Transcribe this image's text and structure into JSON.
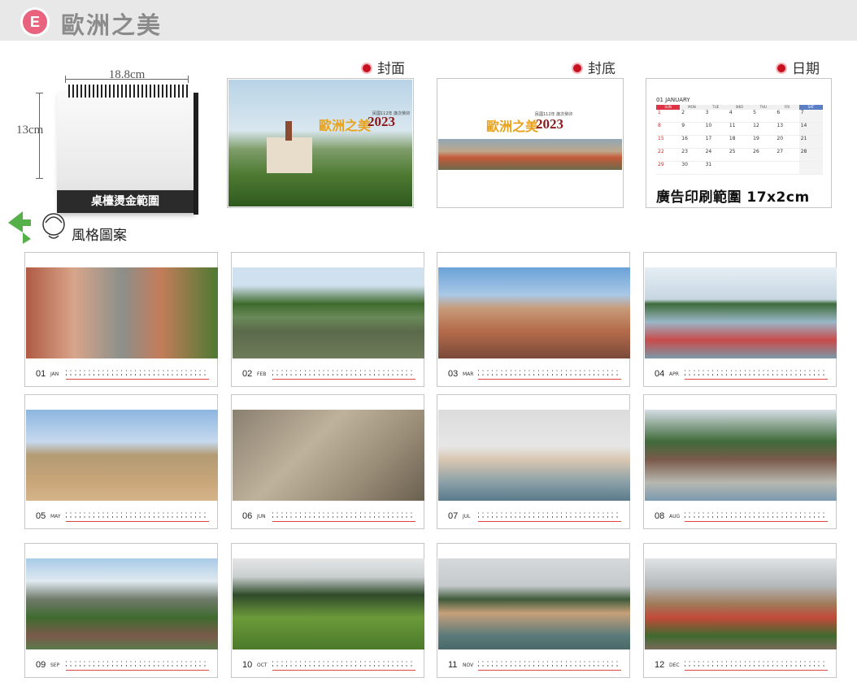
{
  "header": {
    "badge": "E",
    "title": "歐洲之美"
  },
  "desk": {
    "width_label": "18.8cm",
    "height_label": "13cm",
    "band_text": "桌檯燙金範圍"
  },
  "sections": {
    "cover": "封面",
    "back": "封底",
    "date": "日期"
  },
  "cover": {
    "brand": "歐洲之美",
    "year": "2023",
    "sub": "民國112年 歲次癸卯"
  },
  "date_card": {
    "month_head": "01 JANUARY",
    "dow": [
      "SUN",
      "MON",
      "TUE",
      "WED",
      "THU",
      "FRI",
      "SAT"
    ],
    "weeks": [
      [
        "1",
        "2",
        "3",
        "4",
        "5",
        "6",
        "7"
      ],
      [
        "8",
        "9",
        "10",
        "11",
        "12",
        "13",
        "14"
      ],
      [
        "15",
        "16",
        "17",
        "18",
        "19",
        "20",
        "21"
      ],
      [
        "22",
        "23",
        "24",
        "25",
        "26",
        "27",
        "28"
      ],
      [
        "29",
        "30",
        "31",
        "",
        "",
        "",
        ""
      ]
    ],
    "ad_text": "廣告印刷範圍 17x2cm"
  },
  "style_label": "風格圖案",
  "months": [
    {
      "num": "01",
      "mon": "JAN"
    },
    {
      "num": "02",
      "mon": "FEB"
    },
    {
      "num": "03",
      "mon": "MAR"
    },
    {
      "num": "04",
      "mon": "APR"
    },
    {
      "num": "05",
      "mon": "MAY"
    },
    {
      "num": "06",
      "mon": "JUN"
    },
    {
      "num": "07",
      "mon": "JUL"
    },
    {
      "num": "08",
      "mon": "AUG"
    },
    {
      "num": "09",
      "mon": "SEP"
    },
    {
      "num": "10",
      "mon": "OCT"
    },
    {
      "num": "11",
      "mon": "NOV"
    },
    {
      "num": "12",
      "mon": "DEC"
    }
  ],
  "colors": {
    "badge": "#e9637f",
    "accent_red": "#c8101e",
    "year_red": "#8c1a1a",
    "brand_gold": "#e8a21b"
  }
}
